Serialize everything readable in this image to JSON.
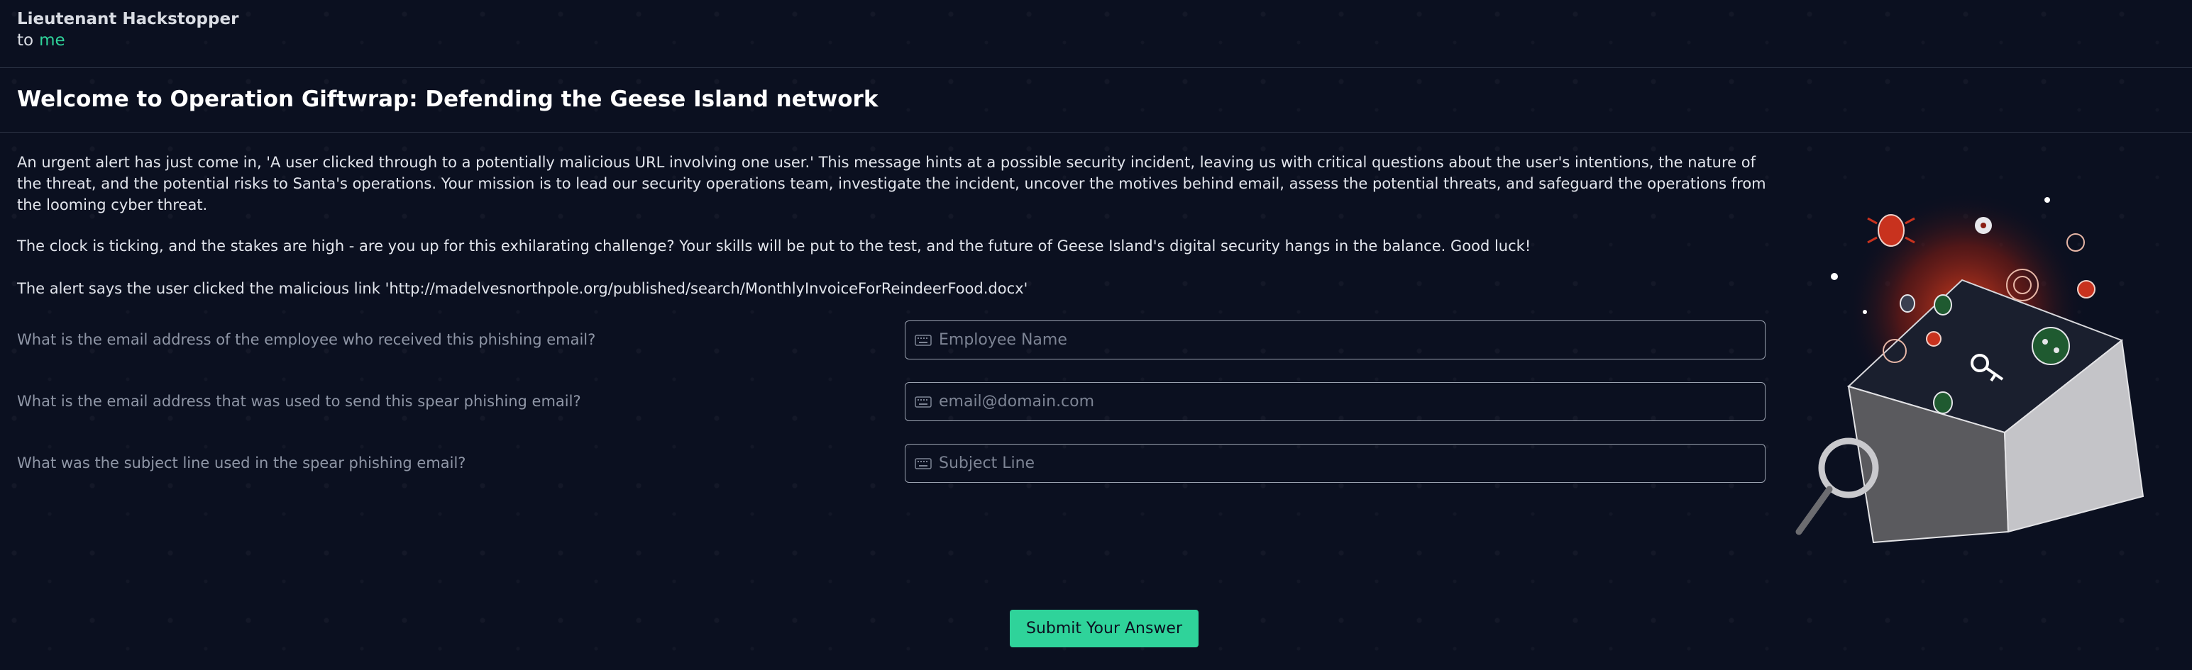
{
  "email": {
    "sender": "Lieutenant Hackstopper",
    "to_label": "to",
    "recipient": "me",
    "title": "Welcome to Operation Giftwrap: Defending the Geese Island network",
    "paragraphs": [
      "An urgent alert has just come in, 'A user clicked through to a potentially malicious URL involving one user.' This message hints at a possible security incident, leaving us with critical questions about the user's intentions, the nature of the threat, and the potential risks to Santa's operations. Your mission is to lead our security operations team, investigate the incident, uncover the motives behind email, assess the potential threats, and safeguard the operations from the looming cyber threat.",
      "The clock is ticking, and the stakes are high - are you up for this exhilarating challenge? Your skills will be put to the test, and the future of Geese Island's digital security hangs in the balance. Good luck!",
      "The alert says the user clicked the malicious link 'http://madelvesnorthpole.org/published/search/MonthlyInvoiceForReindeerFood.docx'"
    ]
  },
  "form": {
    "questions": [
      {
        "label": "What is the email address of the employee who received this phishing email?",
        "placeholder": "Employee Name"
      },
      {
        "label": "What is the email address that was used to send this spear phishing email?",
        "placeholder": "email@domain.com"
      },
      {
        "label": "What was the subject line used in the spear phishing email?",
        "placeholder": "Subject Line"
      }
    ],
    "submit_label": "Submit Your Answer"
  },
  "colors": {
    "background": "#0b1020",
    "accent": "#2fd39a",
    "field_border": "#9aa1af",
    "question_text": "#8f96a6"
  },
  "icons": [
    "keyboard-icon",
    "envelope-illustration",
    "magnifier-icon",
    "bug-icon",
    "virus-icon",
    "key-icon"
  ]
}
